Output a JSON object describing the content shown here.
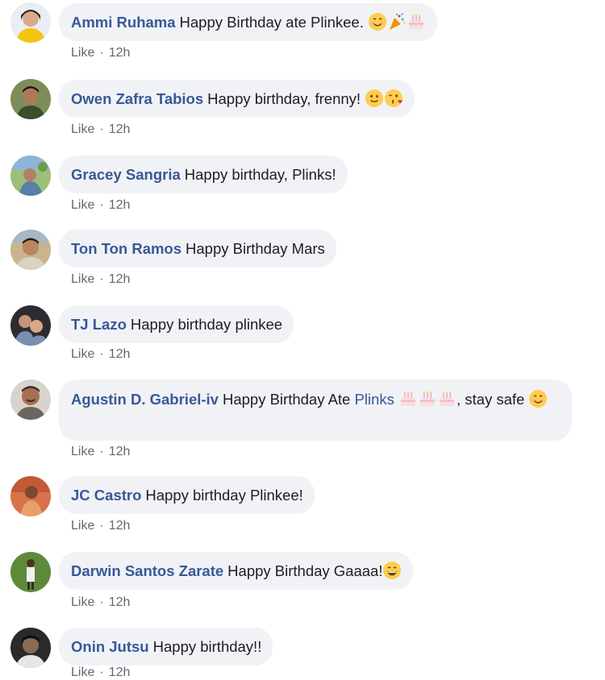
{
  "comments": [
    {
      "author": "Ammi Ruhama",
      "text": "Happy Birthday ate Plinkee.",
      "emojis": [
        "smiling-face-icon",
        "party-popper-icon",
        "birthday-cake-icon"
      ],
      "like_label": "Like",
      "time": "12h"
    },
    {
      "author": "Owen Zafra Tabios",
      "text": "Happy birthday, frenny!",
      "emojis": [
        "slightly-smiling-face-icon",
        "face-blowing-kiss-icon"
      ],
      "like_label": "Like",
      "time": "12h"
    },
    {
      "author": "Gracey Sangria",
      "text": "Happy birthday, Plinks!",
      "emojis": [],
      "like_label": "Like",
      "time": "12h"
    },
    {
      "author": "Ton Ton Ramos",
      "text": "Happy Birthday Mars",
      "emojis": [],
      "like_label": "Like",
      "time": "12h"
    },
    {
      "author": "TJ Lazo",
      "text": "Happy birthday plinkee",
      "emojis": [],
      "like_label": "Like",
      "time": "12h"
    },
    {
      "author": "Agustin D. Gabriel-iv",
      "text": "Happy Birthday Ate",
      "mention": "Plinks",
      "emojis": [
        "birthday-cake-icon",
        "birthday-cake-icon",
        "birthday-cake-icon"
      ],
      "text_after": ", stay safe",
      "emojis_after": [
        "smiling-face-icon"
      ],
      "like_label": "Like",
      "time": "12h"
    },
    {
      "author": "JC Castro",
      "text": "Happy birthday Plinkee!",
      "emojis": [],
      "like_label": "Like",
      "time": "12h"
    },
    {
      "author": "Darwin Santos Zarate",
      "text": "Happy Birthday Gaaaa!",
      "emojis": [
        "grinning-face-icon"
      ],
      "like_label": "Like",
      "time": "12h"
    },
    {
      "author": "Onin Jutsu",
      "text": "Happy birthday!!",
      "emojis": [],
      "like_label": "Like",
      "time": "12h"
    }
  ],
  "colors": {
    "author": "#385898",
    "bubble": "#f0f2f5",
    "meta": "#65676b"
  }
}
